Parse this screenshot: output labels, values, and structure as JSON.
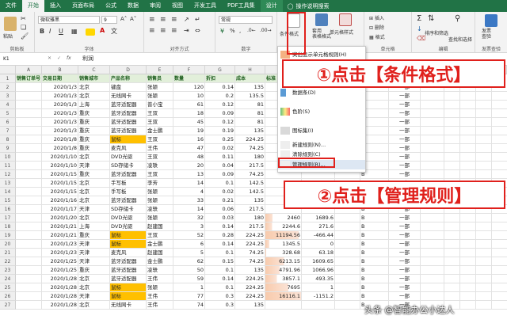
{
  "menubar": {
    "tabs": [
      "文件",
      "开始",
      "插入",
      "页面布局",
      "公式",
      "数据",
      "审阅",
      "视图",
      "开发工具",
      "PDF工具集",
      "设计"
    ],
    "active": "开始",
    "tell_me": "操作说明搜索"
  },
  "ribbon": {
    "clipboard": {
      "label": "剪贴板",
      "paste": "粘贴"
    },
    "font": {
      "label": "字体",
      "font_name": "微软雅黑",
      "font_size": "9",
      "bold": "B",
      "italic": "I",
      "underline": "U"
    },
    "align": {
      "label": "对齐方式"
    },
    "number": {
      "label": "数字",
      "format": "常规"
    },
    "styles": {
      "cond_fmt": "条件格式",
      "table_fmt": "套用\n表格格式",
      "cell_styles": "单元格样式"
    },
    "cells": {
      "label": "单元格",
      "insert": "插入",
      "delete": "删除",
      "format": "格式"
    },
    "editing": {
      "label": "编辑",
      "sort": "排序和筛选",
      "find": "查找和选择"
    },
    "invoice": {
      "label": "发票查验",
      "check": "发票\n查验"
    }
  },
  "formula_bar": {
    "name_box": "K1",
    "fx": "fx",
    "value": "利润"
  },
  "columns": [
    "A",
    "B",
    "C",
    "D",
    "E",
    "F",
    "G",
    "H",
    "I",
    "J",
    "K",
    "L",
    "M",
    "N",
    "O",
    "P",
    "Q",
    "R"
  ],
  "headers": [
    "销售订单号",
    "交易日期",
    "销售城市",
    "产品名称",
    "销售员",
    "数量",
    "折扣",
    "成本",
    "标准"
  ],
  "rows": [
    [
      "2020/1/3",
      "北京",
      "键盘",
      "张颖",
      "120",
      "0.14",
      "135",
      "",
      "",
      "",
      "一部"
    ],
    [
      "2020/1/3",
      "北京",
      "无线网卡",
      "张颖",
      "10",
      "0.2",
      "135.5",
      "",
      "",
      "",
      "一部"
    ],
    [
      "2020/1/3",
      "上海",
      "蓝牙适配器",
      "普小宝",
      "61",
      "0.12",
      "81",
      "",
      "",
      "",
      "一部"
    ],
    [
      "2020/1/3",
      "重庆",
      "蓝牙适配器",
      "王双",
      "18",
      "0.09",
      "81",
      "",
      "",
      "",
      "一部"
    ],
    [
      "2020/1/3",
      "重庆",
      "蓝牙适配器",
      "王双",
      "45",
      "0.12",
      "81",
      "",
      "",
      "",
      "一部"
    ],
    [
      "2020/1/3",
      "重庆",
      "蓝牙适配器",
      "金士鹏",
      "19",
      "0.19",
      "135",
      "",
      "",
      "",
      "一部"
    ],
    [
      "2020/1/8",
      "重庆",
      "鼠标",
      "王双",
      "16",
      "0.25",
      "224.25",
      "",
      "",
      "",
      "一部"
    ],
    [
      "2020/1/8",
      "重庆",
      "麦克风",
      "王伟",
      "47",
      "0.02",
      "74.25",
      "",
      "",
      "",
      "一部"
    ],
    [
      "2020/1/10",
      "北京",
      "DVD光驱",
      "王双",
      "48",
      "0.11",
      "180",
      "",
      "",
      "",
      "一部"
    ],
    [
      "2020/1/10",
      "天津",
      "SD存储卡",
      "凌轶",
      "20",
      "0.04",
      "217.5",
      "",
      "",
      "",
      "一部"
    ],
    [
      "2020/1/15",
      "重庆",
      "蓝牙适配器",
      "王双",
      "13",
      "0.09",
      "74.25",
      "",
      "",
      "",
      "一部"
    ],
    [
      "2020/1/15",
      "北京",
      "手写板",
      "李芳",
      "14",
      "0.1",
      "142.5",
      "",
      "",
      "",
      "一部"
    ],
    [
      "2020/1/15",
      "北京",
      "手写板",
      "张颖",
      "4",
      "0.02",
      "142.5",
      "",
      "",
      "",
      "一部"
    ],
    [
      "2020/1/16",
      "北京",
      "蓝牙适配器",
      "张颖",
      "33",
      "0.21",
      "135",
      "",
      "",
      "",
      "一部"
    ],
    [
      "2020/1/17",
      "天津",
      "SD存储卡",
      "凌轶",
      "14",
      "0.06",
      "217.5",
      "",
      "",
      "",
      "一部"
    ],
    [
      "2020/1/20",
      "北京",
      "DVD光驱",
      "张颖",
      "32",
      "0.03",
      "180",
      "2460",
      "1689.6",
      "",
      "一部"
    ],
    [
      "2020/1/21",
      "上海",
      "DVD光驱",
      "赵建国",
      "3",
      "0.14",
      "217.5",
      "2244.6",
      "271.6",
      "",
      "一部"
    ],
    [
      "2020/1/21",
      "重庆",
      "鼠标",
      "王双",
      "52",
      "0.28",
      "224.25",
      "11194.56",
      "-466.44",
      "",
      "一部"
    ],
    [
      "2020/1/23",
      "天津",
      "鼠标",
      "金士鹏",
      "6",
      "0.14",
      "224.25",
      "1345.5",
      "0",
      "",
      "一部"
    ],
    [
      "2020/1/23",
      "天津",
      "麦克风",
      "赵建国",
      "5",
      "0.1",
      "74.25",
      "328.68",
      "63.18",
      "",
      "一部"
    ],
    [
      "2020/1/25",
      "天津",
      "蓝牙适配器",
      "金士鹏",
      "62",
      "0.15",
      "74.25",
      "6213.15",
      "1609.65",
      "",
      "一部"
    ],
    [
      "2020/1/25",
      "重庆",
      "蓝牙适配器",
      "凌轶",
      "50",
      "0.1",
      "135",
      "4791.96",
      "1066.96",
      "",
      "一部"
    ],
    [
      "2020/1/28",
      "北京",
      "蓝牙适配器",
      "王伟",
      "59",
      "0.14",
      "224.25",
      "3857.1",
      "493.35",
      "",
      "一部"
    ],
    [
      "2020/1/28",
      "北京",
      "鼠标",
      "张颖",
      "1",
      "0.1",
      "224.25",
      "7695",
      "1",
      "",
      "一部"
    ],
    [
      "2020/1/28",
      "天津",
      "鼠标",
      "王伟",
      "77",
      "0.3",
      "224.25",
      "16116.1",
      "-1151.2",
      "",
      "一部"
    ],
    [
      "2020/1/28",
      "北京",
      "无线网卡",
      "王伟",
      "74",
      "0.3",
      "135",
      "",
      "",
      "",
      "一部"
    ]
  ],
  "k_letters": [
    "B",
    "B",
    "B",
    "B",
    "B",
    "B",
    "B",
    "B",
    "B",
    "B",
    "B",
    "B",
    "B",
    "B",
    "B",
    "B",
    "B",
    "B",
    "B",
    "B",
    "B",
    "B",
    "B",
    "B",
    "B",
    "B"
  ],
  "highlight_col_d": [
    false,
    false,
    false,
    false,
    false,
    false,
    true,
    false,
    false,
    false,
    false,
    false,
    false,
    false,
    false,
    false,
    false,
    true,
    true,
    false,
    false,
    false,
    false,
    true,
    true,
    false
  ],
  "menu": {
    "highlight_rules": "突出显示单元格规则(H)",
    "data_bars": "数据条(D)",
    "color_scales": "色阶(S)",
    "icon_sets": "图标集(I)",
    "new_rule": "新建规则(N)...",
    "clear_rules": "清除规则(C)",
    "manage_rules": "管理规则(R)..."
  },
  "callouts": {
    "step1": "①点击【条件格式】",
    "step2": "②点击【管理规则】"
  },
  "watermark": "头条 @智能办公小达人",
  "colors": {
    "accent": "#217346",
    "callout": "#e0201c",
    "header_fill": "#e2efda",
    "highlight": "#ffc000"
  }
}
